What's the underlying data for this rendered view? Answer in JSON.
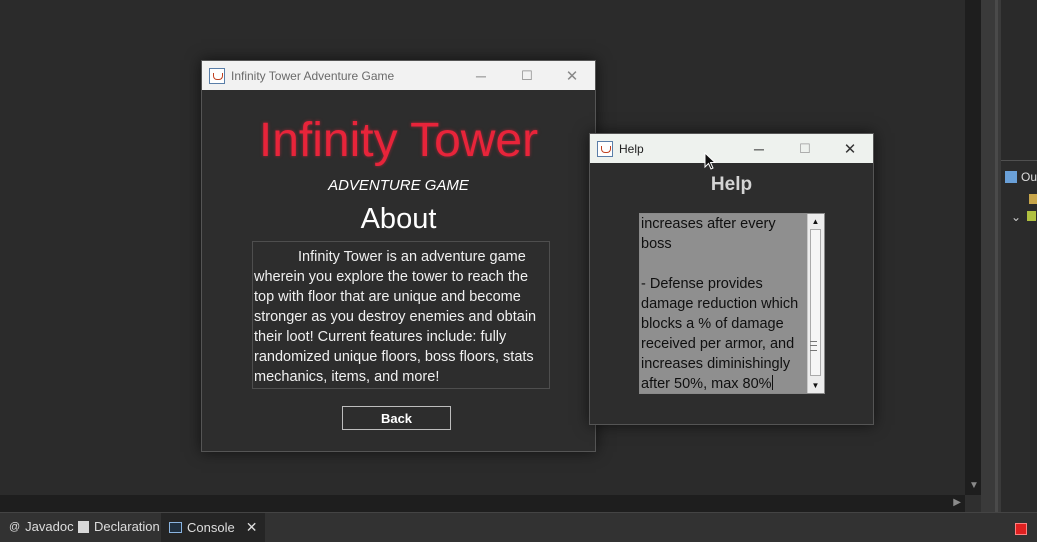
{
  "ide": {
    "bottom_tabs": [
      {
        "label": "Javadoc"
      },
      {
        "label": "Declaration"
      },
      {
        "label": "Console"
      }
    ],
    "right_panel_tab": "Ou"
  },
  "about_window": {
    "title": "Infinity Tower Adventure Game",
    "game_title": "Infinity Tower",
    "subtitle": "ADVENTURE GAME",
    "heading": "About",
    "body": "Infinity Tower is an adventure game wherein you explore the tower to reach the top with floor that are unique and become stronger as you destroy enemies and obtain their loot! Current features include: fully randomized unique floors, boss floors, stats mechanics, items, and more!",
    "back_label": "Back",
    "title_color": "#e8243a"
  },
  "help_window": {
    "title": "Help",
    "heading": "Help",
    "text": "increases after every\nboss\n\n- Defense provides\ndamage reduction which\nblocks a % of damage\nreceived per armor, and\nincreases diminishingly\nafter 50%, max 80%"
  }
}
